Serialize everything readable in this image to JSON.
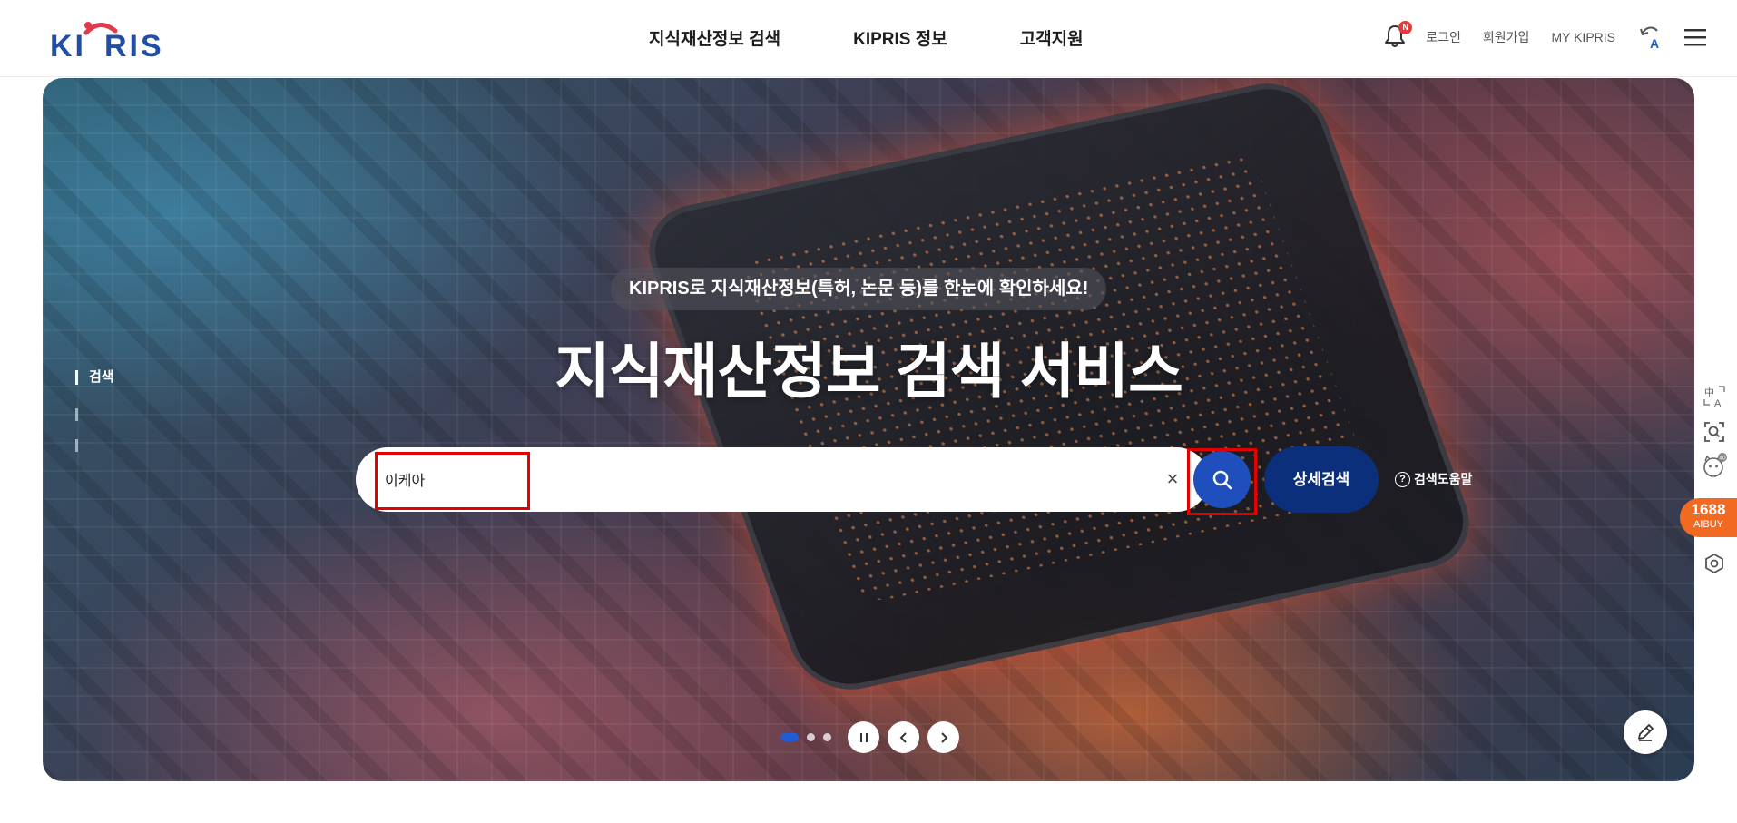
{
  "header": {
    "logo_text": "KIPRIS",
    "nav": [
      {
        "label": "지식재산정보 검색"
      },
      {
        "label": "KIPRIS 정보"
      },
      {
        "label": "고객지원"
      }
    ],
    "notification_badge": "N",
    "login": "로그인",
    "signup": "회원가입",
    "my_kipris": "MY KIPRIS"
  },
  "hero": {
    "tagline": "KIPRIS로 지식재산정보(특허, 논문 등)를 한눈에 확인하세요!",
    "title": "지식재산정보 검색 서비스",
    "side_tab": "검색"
  },
  "search": {
    "value": "이케아",
    "clear": "×",
    "advanced_label": "상세검색",
    "help_label": "검색도움말",
    "help_icon_glyph": "?"
  },
  "carousel": {
    "slide_count": 3,
    "active_index": 0
  },
  "floating": {
    "aibuy_number": "1688",
    "aibuy_label": "AIBUY",
    "translate_icon_text": "中A",
    "pet_badge": "40"
  },
  "colors": {
    "brand_blue": "#1f4fbd",
    "brand_navy": "#0c2f7c",
    "brand_red": "#e23a4c",
    "highlight_red": "#e30000",
    "aibuy_orange": "#f26a21"
  }
}
